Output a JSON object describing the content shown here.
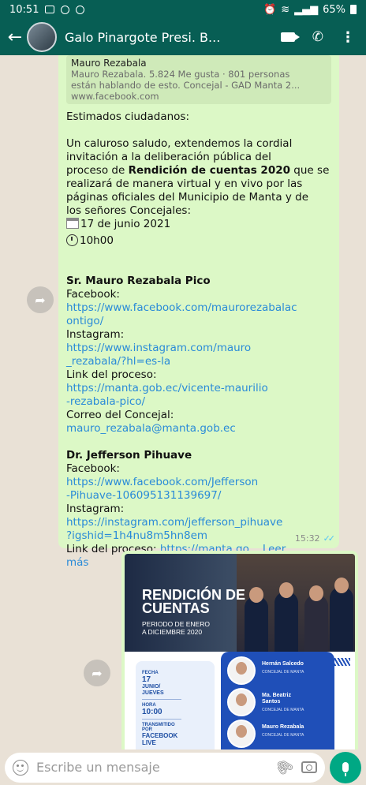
{
  "status_bar": {
    "time": "10:51",
    "battery": "65%"
  },
  "header": {
    "title": "Galo Pinargote Presi. B..."
  },
  "link_preview": {
    "title": "Mauro Rezabala",
    "description_1": "Mauro Rezabala. 5.824 Me gusta · 801 personas",
    "description_2": "están hablando de esto. Concejal - GAD Manta 2...",
    "url": "www.facebook.com"
  },
  "message": {
    "greeting": "Estimados ciudadanos:",
    "intro_1": "Un caluroso saludo, extendemos la cordial",
    "intro_2": "invitación a la deliberación pública del",
    "intro_3a": "proceso de ",
    "intro_3b": "Rendición de cuentas 2020",
    "intro_3c": " que se",
    "intro_4": "realizará de manera virtual y en vivo por las",
    "intro_5": "páginas oficiales del Municipio de Manta y de",
    "intro_6": "los señores Concejales:",
    "date": "17 de junio 2021",
    "time": "10h00",
    "p1_name": "Sr. Mauro Rezabala Pico",
    "p1_fb_label": "Facebook:",
    "p1_fb_1": "https://www.facebook.com/maurorezabalac",
    "p1_fb_2": "ontigo/",
    "p1_ig_label": "Instagram:",
    "p1_ig_1": "https://www.instagram.com/mauro",
    "p1_ig_2": "_rezabala/?hl=es-la",
    "p1_proc_label": "Link del proceso:",
    "p1_proc_1": "https://manta.gob.ec/vicente-maurilio",
    "p1_proc_2": "-rezabala-pico/",
    "p1_mail_label": "Correo del Concejal:",
    "p1_mail": "mauro_rezabala@manta.gob.ec",
    "p2_name": "Dr. Jefferson Pihuave",
    "p2_fb_label": "Facebook:",
    "p2_fb_1": "https://www.facebook.com/Jefferson",
    "p2_fb_2": "-Pihuave-106095131139697/",
    "p2_ig_label": "Instagram:",
    "p2_ig_1": "https://instagram.com/jefferson_pihuave",
    "p2_ig_2": "?igshid=1h4nu8m5hn8em",
    "p2_proc_label": "Link del proceso: ",
    "p2_proc": "https://manta.go...",
    "read_more_a": "Leer",
    "read_more_b": "más",
    "timestamp": "15:32"
  },
  "poster": {
    "title_1": "RENDICIÓN DE",
    "title_2": "CUENTAS",
    "sub_1": "PERIODO DE ENERO",
    "sub_2": "A DICIEMBRE 2020",
    "fecha_label": "FECHA",
    "fecha_day": "17",
    "fecha_month": "JUNIO/",
    "fecha_weekday": "JUEVES",
    "hora_label": "HORA",
    "hora": "10:00",
    "trans_label_1": "TRANSMITIDO",
    "trans_label_2": "POR",
    "trans_1": "FACEBOOK",
    "trans_2": "LIVE",
    "council": [
      {
        "name_1": "Hernán Salcedo",
        "name_2": "",
        "role": "CONCEJAL DE MANTA"
      },
      {
        "name_1": "Ma. Beatriz",
        "name_2": "Santos",
        "role": "CONCEJAL DE MANTA"
      },
      {
        "name_1": "Mauro Rezabala",
        "name_2": "",
        "role": "CONCEJAL DE MANTA"
      }
    ]
  },
  "input": {
    "placeholder": "Escribe un mensaje"
  },
  "colors": {
    "header": "#075e54",
    "bubble": "#dcf8c6",
    "link": "#2a8bd8",
    "mic": "#00a884"
  }
}
